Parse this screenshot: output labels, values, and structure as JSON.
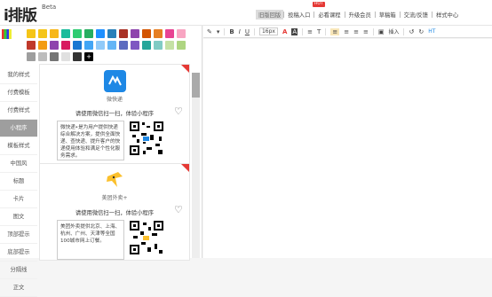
{
  "header": {
    "logo": "i排版",
    "beta": "Beta",
    "nav": [
      {
        "label": "旧版回版",
        "active": true
      },
      {
        "label": "投稿入口",
        "active": false
      },
      {
        "label": "必看课程",
        "active": false
      },
      {
        "label": "升级会员",
        "active": false
      },
      {
        "label": "草稿箱",
        "active": false
      },
      {
        "label": "交流/反馈",
        "active": false
      },
      {
        "label": "样式中心",
        "active": false
      }
    ],
    "hot_badge": "HOT"
  },
  "palette": {
    "row1": [
      "#f5c518",
      "#f5c518",
      "#f7b718",
      "#1abc9c",
      "#2ecc71",
      "#27ae60",
      "#1e90ff",
      "#2980b9",
      "#a93226",
      "#8e44ad",
      "#d35400",
      "#e67e22",
      "#e84393",
      "#f8a5c2"
    ],
    "row2": [
      "#c0392b",
      "#f39c12",
      "#8e44ad",
      "#d81b60",
      "#1976d2",
      "#42a5f5",
      "#90caf9",
      "#64b5f6",
      "#5c6bc0",
      "#7e57c2",
      "#26a69a",
      "#80cbc4",
      "#c5e1a5",
      "#aed581"
    ],
    "row3": [
      "#9e9e9e",
      "#bdbdbd",
      "#757575",
      "#e0e0e0",
      "#333333",
      "#000000"
    ]
  },
  "sidebar": [
    {
      "label": "我的样式",
      "active": false
    },
    {
      "label": "付费模板",
      "active": false
    },
    {
      "label": "付费样式",
      "active": false
    },
    {
      "label": "小程序",
      "active": true
    },
    {
      "label": "模板样式",
      "active": false
    },
    {
      "label": "中国风",
      "active": false
    },
    {
      "label": "标题",
      "active": false
    },
    {
      "label": "卡片",
      "active": false
    },
    {
      "label": "图文",
      "active": false
    },
    {
      "label": "顶部提示",
      "active": false
    },
    {
      "label": "底部提示",
      "active": false
    },
    {
      "label": "分隔线",
      "active": false
    },
    {
      "label": "正文",
      "active": false
    }
  ],
  "cards": [
    {
      "app_name": "微快递",
      "scan_text": "请使用微信扫一扫，体验小程序",
      "desc": "微快递•是为用户提供快递综合解决方案，提供全面快递、查快递、提升客户的快递使用体验和满足个性化服务需求。",
      "icon_color": "#1e88e5"
    },
    {
      "app_name": "美团外卖+",
      "scan_text": "请使用微信扫一扫，体验小程序",
      "desc": "美团外卖提供北京、上海、杭州、广州、天津等全国100城市网上订餐。",
      "icon_color": "#fbc02d"
    }
  ],
  "toolbar": {
    "items": [
      "✎",
      "▾",
      "B",
      "I",
      "U",
      "16px",
      "A",
      "A",
      "≡",
      "T",
      "≡",
      "≡",
      "≡",
      "≡",
      "▣",
      "插入",
      "↺",
      "↻",
      "HT"
    ]
  }
}
